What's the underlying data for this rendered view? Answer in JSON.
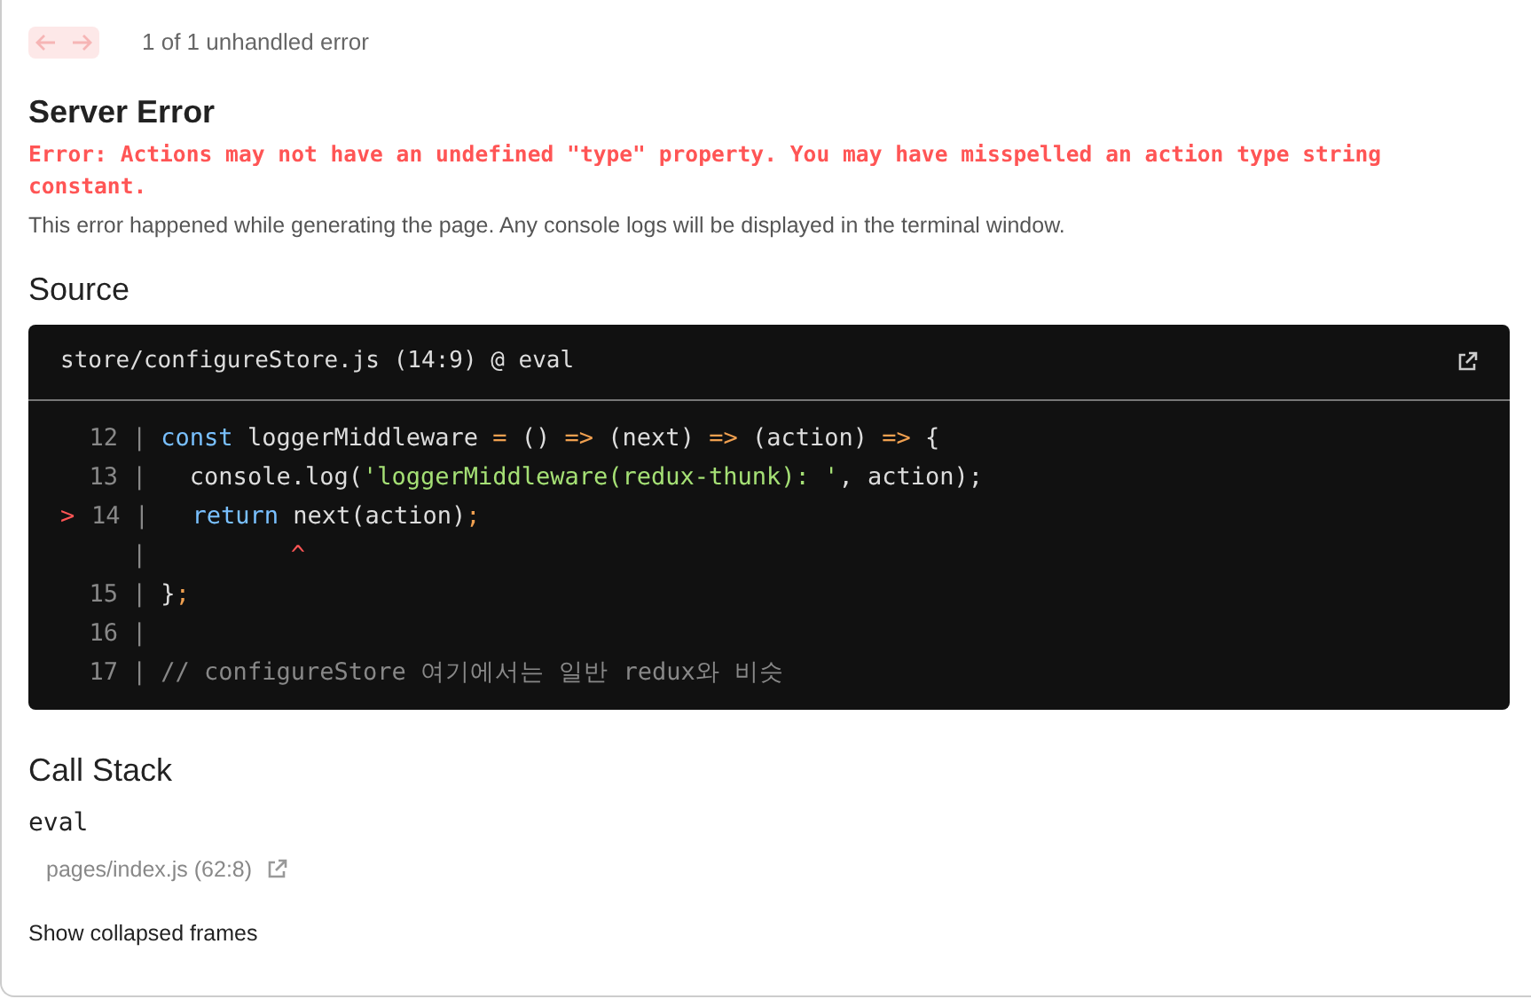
{
  "nav": {
    "prev_disabled": true,
    "next_disabled": true,
    "count": "1 of 1 unhandled error"
  },
  "title": "Server Error",
  "error_message": "Error: Actions may not have an undefined \"type\" property. You may have misspelled an action type string constant.",
  "description": "This error happened while generating the page. Any console logs will be displayed in the terminal window.",
  "source": {
    "heading": "Source",
    "file": "store/configureStore.js (14:9) @ eval",
    "lines": [
      {
        "number": "12",
        "separator": "|",
        "tokens": [
          {
            "kind": "keyword",
            "text": "const"
          },
          {
            "kind": "plain",
            "text": " loggerMiddleware "
          },
          {
            "kind": "punct",
            "text": "="
          },
          {
            "kind": "plain",
            "text": " () "
          },
          {
            "kind": "punct",
            "text": "=>"
          },
          {
            "kind": "plain",
            "text": " (next) "
          },
          {
            "kind": "punct",
            "text": "=>"
          },
          {
            "kind": "plain",
            "text": " (action) "
          },
          {
            "kind": "punct",
            "text": "=>"
          },
          {
            "kind": "plain",
            "text": " {"
          }
        ]
      },
      {
        "number": "13",
        "separator": "|",
        "tokens": [
          {
            "kind": "plain",
            "text": "  console.log("
          },
          {
            "kind": "string",
            "text": "'loggerMiddleware(redux-thunk): '"
          },
          {
            "kind": "plain",
            "text": ", action);"
          }
        ]
      },
      {
        "marker": ">",
        "number": "14",
        "separator": "|",
        "tokens": [
          {
            "kind": "keyword",
            "text": "  return"
          },
          {
            "kind": "plain",
            "text": " next(action)"
          },
          {
            "kind": "punct",
            "text": ";"
          }
        ]
      },
      {
        "separator": "|",
        "tokens": [
          {
            "kind": "caret",
            "text": "         ^"
          }
        ]
      },
      {
        "number": "15",
        "separator": "|",
        "tokens": [
          {
            "kind": "plain",
            "text": "}"
          },
          {
            "kind": "punct",
            "text": ";"
          }
        ]
      },
      {
        "number": "16",
        "separator": "|"
      },
      {
        "number": "17",
        "separator": "|",
        "tokens": [
          {
            "kind": "comment",
            "text": "// configureStore 여기에서는 일반 redux와 비슷"
          }
        ]
      }
    ]
  },
  "call_stack": {
    "heading": "Call Stack",
    "frames": [
      {
        "function": "eval",
        "location": "pages/index.js (62:8)"
      }
    ],
    "toggle": "Show collapsed frames"
  }
}
